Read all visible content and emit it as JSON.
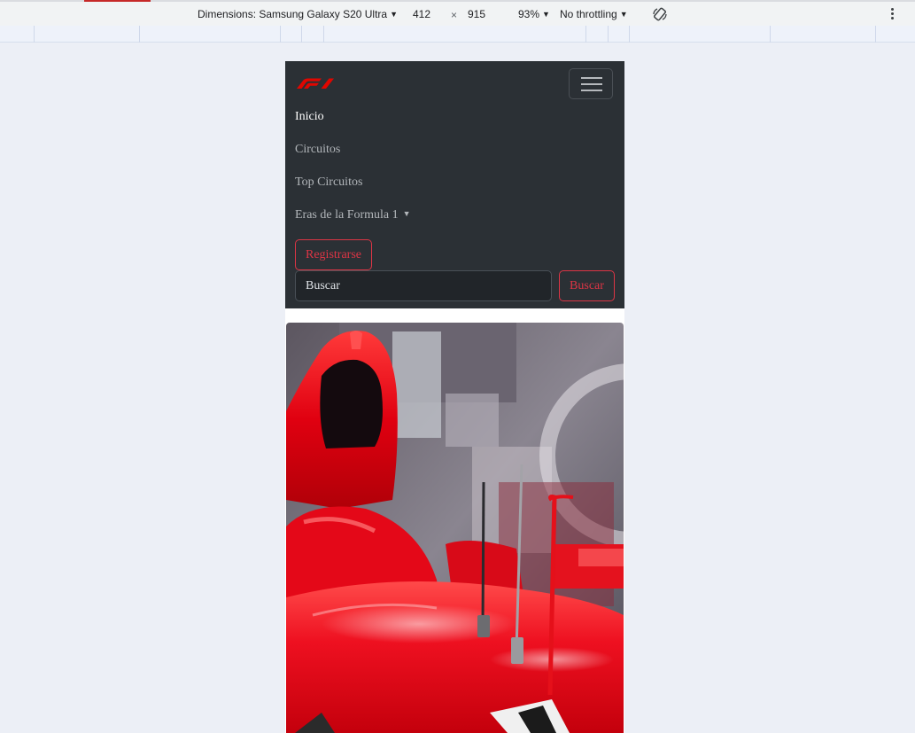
{
  "devtools": {
    "device_label": "Dimensions: Samsung Galaxy S20 Ultra",
    "width_value": "412",
    "times_symbol": "×",
    "height_value": "915",
    "zoom_label": "93%",
    "throttle_label": "No throttling",
    "icons": {
      "rotate": "rotate-icon",
      "menu": "more-vertical-icon"
    },
    "accent_color": "#c62828"
  },
  "site": {
    "brand_color": "#e10600",
    "logo": "f1-logo",
    "nav": {
      "items": [
        {
          "label": "Inicio",
          "active": true
        },
        {
          "label": "Circuitos",
          "active": false
        },
        {
          "label": "Top Circuitos",
          "active": false
        },
        {
          "label": "Eras de la Formula 1",
          "active": false,
          "dropdown": true
        }
      ],
      "register_label": "Registrarse",
      "search_placeholder": "Buscar",
      "search_button_label": "Buscar",
      "toggler_icon": "hamburger-menu-icon"
    },
    "hero_image": "red-formula-1-car-closeup"
  }
}
